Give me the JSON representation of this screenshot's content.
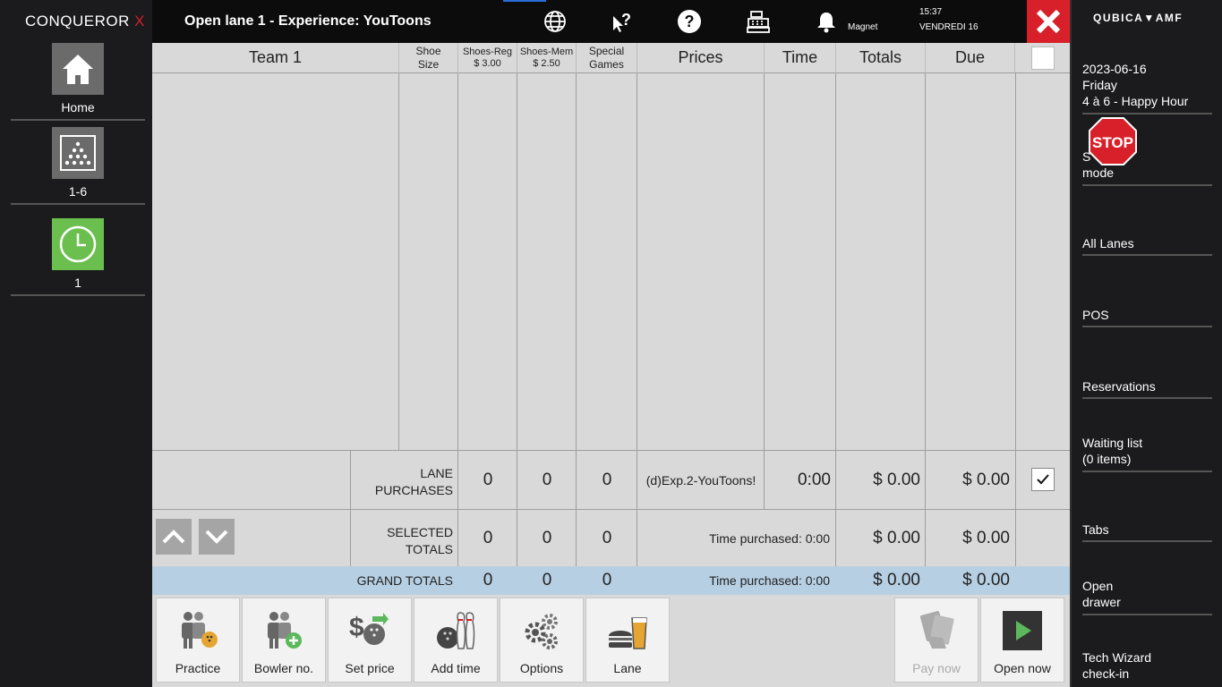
{
  "left_sidebar": {
    "brand_name": "CONQUEROR",
    "brand_mark": "X",
    "items": [
      {
        "label": "Home",
        "icon": "home-icon"
      },
      {
        "label": "1-6",
        "icon": "pins-icon"
      },
      {
        "label": "1",
        "icon": "clock-icon"
      }
    ]
  },
  "topbar": {
    "title": "Open lane 1 - Experience: YouToons",
    "notification_label": "Magnet",
    "time": "15:37",
    "date": "VENDREDI 16"
  },
  "right_sidebar": {
    "logo": "QUBICA▼AMF",
    "date": "2023-06-16",
    "day": "Friday",
    "period": "4 à 6 - Happy Hour",
    "stop_label": "STOP",
    "stop_mode_partial": "S",
    "stop_mode_text": "mode",
    "items": [
      "All Lanes",
      "POS",
      "Reservations",
      "Waiting list",
      "(0 items)",
      "Tabs",
      "Open",
      "drawer",
      "Tech Wizard",
      "check-in"
    ]
  },
  "table": {
    "headers": {
      "team": "Team 1",
      "shoe_size_1": "Shoe",
      "shoe_size_2": "Size",
      "shoes_reg_1": "Shoes-Reg",
      "shoes_reg_2": "$ 3.00",
      "shoes_mem_1": "Shoes-Mem",
      "shoes_mem_2": "$ 2.50",
      "special_1": "Special",
      "special_2": "Games",
      "prices": "Prices",
      "time": "Time",
      "totals": "Totals",
      "due": "Due"
    },
    "lane_purchases": {
      "label_1": "LANE",
      "label_2": "PURCHASES",
      "shoes_reg": "0",
      "shoes_mem": "0",
      "special": "0",
      "price": "(d)Exp.2-YouToons!",
      "time": "0:00",
      "totals": "$ 0.00",
      "due": "$ 0.00"
    },
    "selected_totals": {
      "label_1": "SELECTED",
      "label_2": "TOTALS",
      "shoes_reg": "0",
      "shoes_mem": "0",
      "special": "0",
      "time_purchased": "Time purchased: 0:00",
      "totals": "$ 0.00",
      "due": "$ 0.00"
    },
    "grand_totals": {
      "label": "GRAND TOTALS",
      "shoes_reg": "0",
      "shoes_mem": "0",
      "special": "0",
      "time_purchased": "Time purchased: 0:00",
      "totals": "$ 0.00",
      "due": "$ 0.00"
    }
  },
  "toolbar": {
    "buttons": [
      {
        "label": "Practice",
        "icon": "practice-icon"
      },
      {
        "label": "Bowler no.",
        "icon": "bowler-add-icon"
      },
      {
        "label": "Set price",
        "icon": "set-price-icon"
      },
      {
        "label": "Add time",
        "icon": "add-time-icon"
      },
      {
        "label": "Options",
        "icon": "options-gear-icon"
      },
      {
        "label": "Lane",
        "icon": "lane-food-icon"
      }
    ],
    "pay_now": "Pay now",
    "open_now": "Open now"
  },
  "colors": {
    "accent_red": "#d8202a",
    "clock_green": "#6bbf4e",
    "grand_totals_blue": "#b6cfe3",
    "background_dark": "#1b1b1d"
  }
}
